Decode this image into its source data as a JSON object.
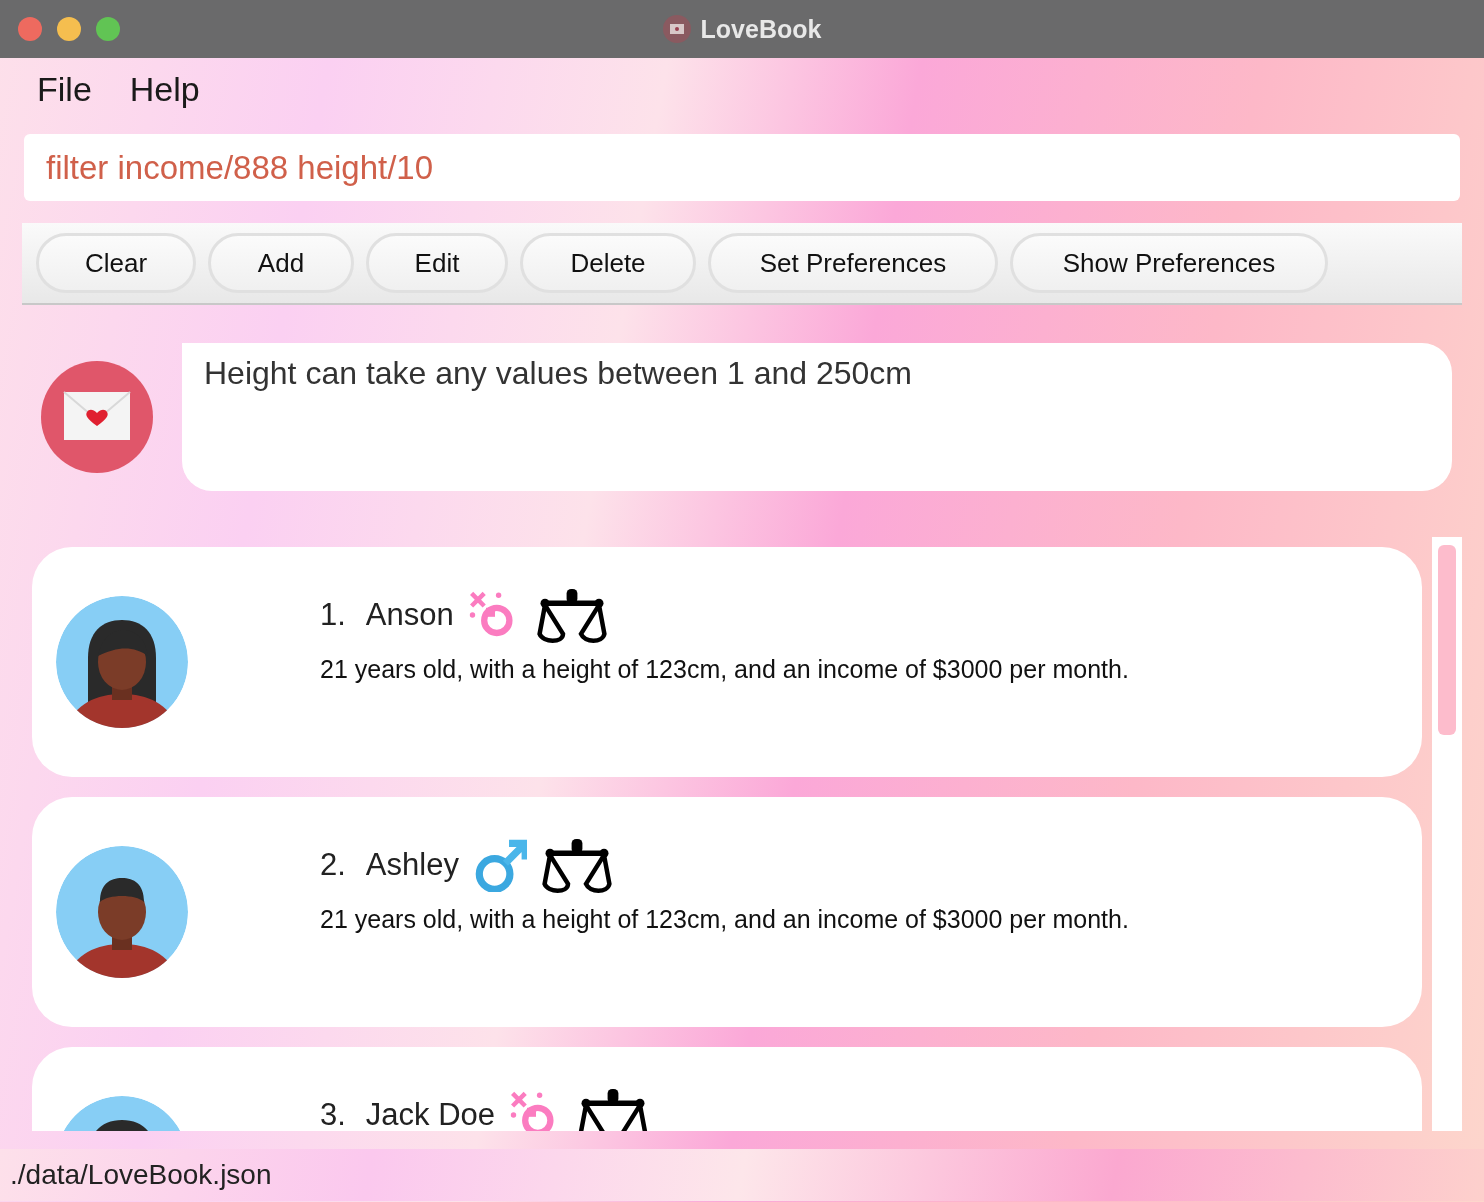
{
  "window": {
    "title": "LoveBook"
  },
  "menu": [
    "File",
    "Help"
  ],
  "command_box": {
    "value": "filter income/888 height/10"
  },
  "buttons": [
    "Clear",
    "Add",
    "Edit",
    "Delete",
    "Set Preferences",
    "Show Preferences"
  ],
  "result": {
    "message": "Height can take any values between 1 and 250cm"
  },
  "persons": [
    {
      "index": "1.",
      "name": "Anson",
      "kind": "female",
      "description": "21 years old, with a height of 123cm, and an income of $3000 per month."
    },
    {
      "index": "2.",
      "name": "Ashley",
      "kind": "male",
      "description": "21 years old, with a height of 123cm, and an income of $3000 per month."
    },
    {
      "index": "3.",
      "name": "Jack Doe",
      "kind": "female"
    }
  ],
  "status_bar": {
    "path": "./data/LoveBook.json"
  }
}
